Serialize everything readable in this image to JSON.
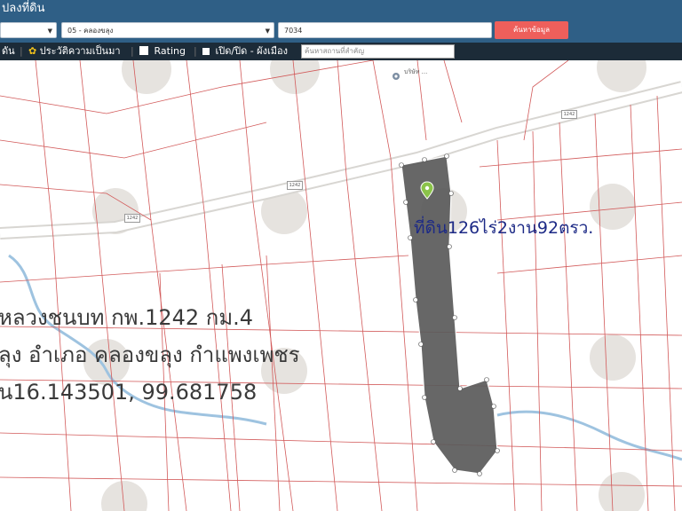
{
  "header": {
    "title": "ปลงที่ดิน"
  },
  "search": {
    "province_value": "",
    "district_value": "05 - คลองขลุง",
    "parcel_value": "7034",
    "submit_label": "ค้นหาข้อมูล"
  },
  "toolbar": {
    "item1": "ดัน",
    "history_label": "ประวัติความเป็นมา",
    "rating_label": "Rating",
    "toggle_label": "เปิด/ปิด - ผังเมือง",
    "place_placeholder": "ค้นหาสถานที่สำคัญ"
  },
  "map": {
    "area_label": "ที่ดิน126ไร่2งาน92ตรว.",
    "address_line1": "หลวงชนบท กพ.1242 กม.4",
    "address_line2": "ลุง อำเภอ คลองขลุง กำแพงเพชร",
    "address_line3": "น16.143501, 99.681758",
    "poi1": "บริษัท ...",
    "road_code": "1242",
    "parcel_color": "#5a5a5a",
    "boundary_color": "#d25a5a"
  }
}
